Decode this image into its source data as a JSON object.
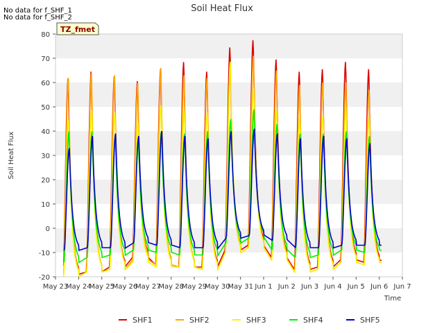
{
  "chart_data": {
    "type": "line",
    "title": "Soil Heat Flux",
    "xlabel": "Time",
    "ylabel": "Soil Heat Flux",
    "notices": [
      "No data for f_SHF_1",
      "No data for f_SHF_2"
    ],
    "badge": "TZ_fmet",
    "x_ticks": [
      "May 23",
      "May 24",
      "May 25",
      "May 26",
      "May 27",
      "May 28",
      "May 29",
      "May 30",
      "May 31",
      "Jun 1",
      "Jun 2",
      "Jun 3",
      "Jun 4",
      "Jun 5",
      "Jun 6",
      "Jun 7"
    ],
    "y_ticks": [
      -20,
      -10,
      0,
      10,
      20,
      30,
      40,
      50,
      60,
      70,
      80
    ],
    "xlim": [
      0,
      15
    ],
    "ylim": [
      -20,
      80
    ],
    "grid": "horizontal bands",
    "legend_position": "bottom",
    "day_index": [
      0,
      1,
      2,
      3,
      4,
      5,
      6,
      7,
      8,
      9,
      10,
      11,
      12,
      13,
      14
    ],
    "data_start": 0.35,
    "data_end": 14.1,
    "series": [
      {
        "name": "SHF1",
        "color": "#dd0000",
        "peaks": [
          62,
          65,
          63,
          61,
          66,
          69,
          65,
          75,
          78,
          70,
          65,
          66,
          69,
          66
        ],
        "mins": [
          -19,
          -18,
          -16,
          -12,
          -15,
          -16,
          -16,
          -9,
          -7,
          -12,
          -17,
          -16,
          -13,
          -14
        ]
      },
      {
        "name": "SHF2",
        "color": "#ffa500",
        "peaks": [
          62,
          64,
          63,
          60,
          66,
          63,
          62,
          68,
          71,
          65,
          59,
          60,
          60,
          57
        ],
        "mins": [
          -20,
          -18,
          -17,
          -13,
          -15,
          -16,
          -17,
          -10,
          -8,
          -13,
          -18,
          -17,
          -14,
          -15
        ]
      },
      {
        "name": "SHF3",
        "color": "#f5f500",
        "peaks": [
          45,
          49,
          48,
          44,
          51,
          49,
          48,
          69,
          58,
          49,
          46,
          47,
          50,
          46
        ],
        "mins": [
          -20,
          -18,
          -17,
          -14,
          -16,
          -16,
          -17,
          -10,
          -8,
          -13,
          -18,
          -17,
          -14,
          -15
        ]
      },
      {
        "name": "SHF4",
        "color": "#00ee00",
        "peaks": [
          40,
          40,
          38,
          37,
          40,
          39,
          40,
          45,
          49,
          43,
          39,
          39,
          40,
          38
        ],
        "mins": [
          -14,
          -12,
          -11,
          -9,
          -10,
          -11,
          -11,
          -6,
          -4,
          -9,
          -12,
          -11,
          -9,
          -10
        ]
      },
      {
        "name": "SHF5",
        "color": "#0000cc",
        "peaks": [
          33,
          38,
          39,
          38,
          40,
          38,
          37,
          40,
          41,
          39,
          37,
          38,
          37,
          35
        ],
        "mins": [
          -9,
          -8,
          -8,
          -6,
          -7,
          -8,
          -8,
          -4,
          -3,
          -5,
          -8,
          -8,
          -7,
          -7
        ]
      }
    ]
  }
}
